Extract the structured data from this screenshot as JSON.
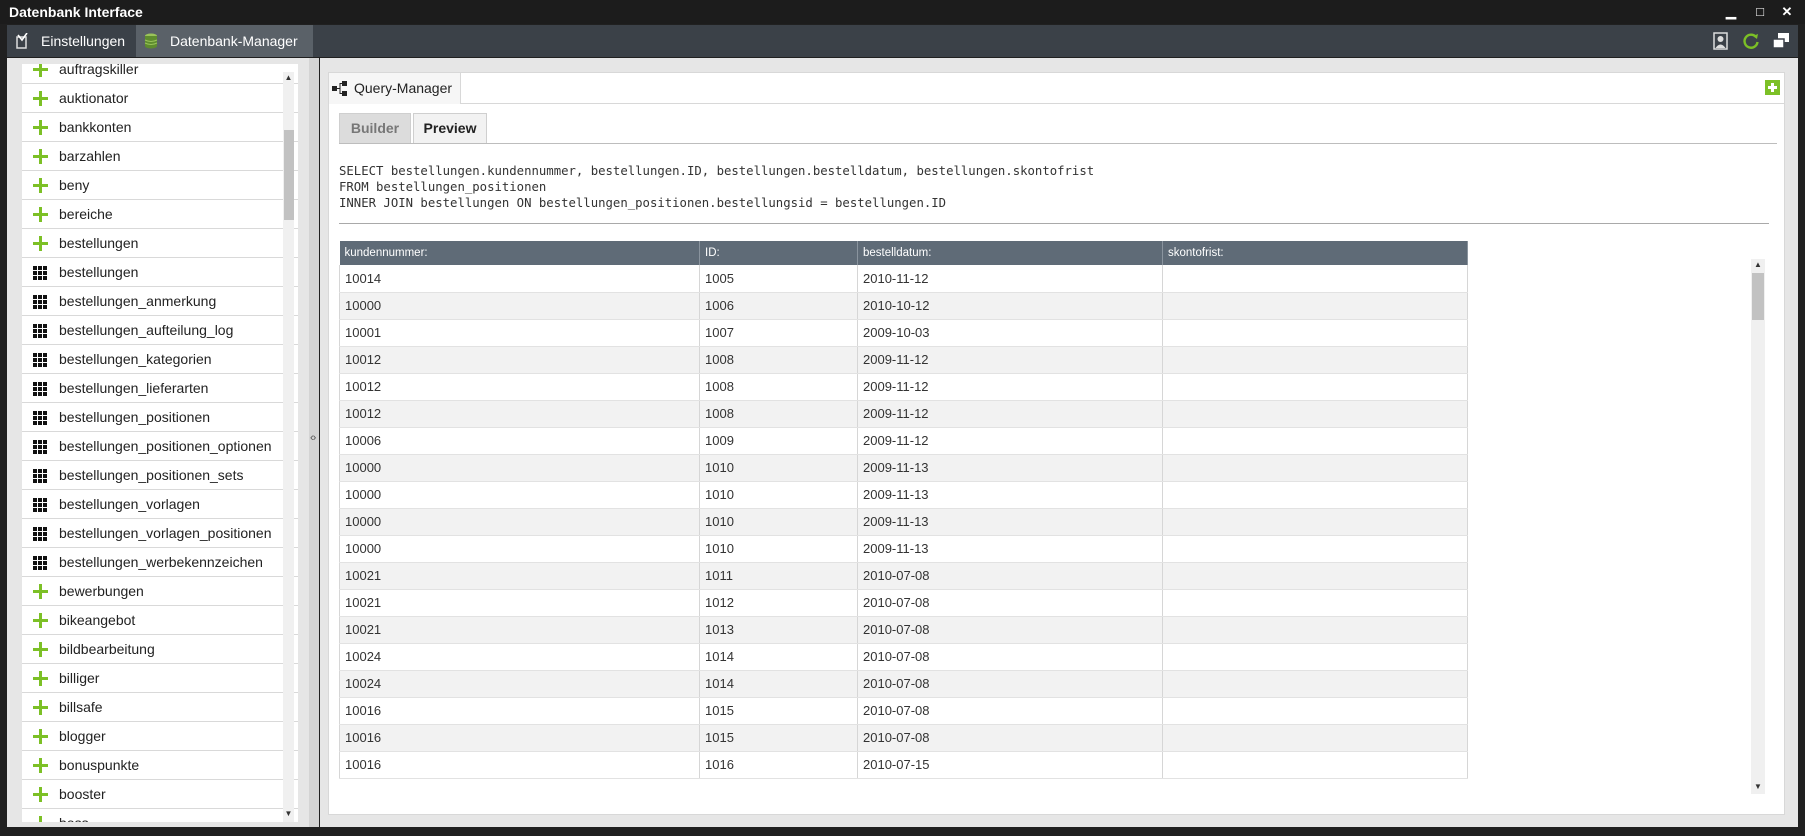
{
  "window": {
    "title": "Datenbank Interface",
    "minimize": "▁",
    "maximize": "□",
    "close": "✕"
  },
  "menubar": {
    "tabs": [
      {
        "label": "Einstellungen",
        "icon": "checklist-icon"
      },
      {
        "label": "Datenbank-Manager",
        "icon": "database-icon",
        "active": true
      }
    ],
    "right_icons": [
      "user-icon",
      "refresh-icon",
      "window-switch-icon"
    ]
  },
  "sidebar": {
    "items": [
      {
        "label": "auftragskiller",
        "icon": "plus"
      },
      {
        "label": "auktionator",
        "icon": "plus"
      },
      {
        "label": "bankkonten",
        "icon": "plus"
      },
      {
        "label": "barzahlen",
        "icon": "plus"
      },
      {
        "label": "beny",
        "icon": "plus"
      },
      {
        "label": "bereiche",
        "icon": "plus"
      },
      {
        "label": "bestellungen",
        "icon": "plus"
      },
      {
        "label": "bestellungen",
        "icon": "table"
      },
      {
        "label": "bestellungen_anmerkung",
        "icon": "table"
      },
      {
        "label": "bestellungen_aufteilung_log",
        "icon": "table"
      },
      {
        "label": "bestellungen_kategorien",
        "icon": "table"
      },
      {
        "label": "bestellungen_lieferarten",
        "icon": "table"
      },
      {
        "label": "bestellungen_positionen",
        "icon": "table"
      },
      {
        "label": "bestellungen_positionen_optionen",
        "icon": "table"
      },
      {
        "label": "bestellungen_positionen_sets",
        "icon": "table"
      },
      {
        "label": "bestellungen_vorlagen",
        "icon": "table"
      },
      {
        "label": "bestellungen_vorlagen_positionen",
        "icon": "table"
      },
      {
        "label": "bestellungen_werbekennzeichen",
        "icon": "table"
      },
      {
        "label": "bewerbungen",
        "icon": "plus"
      },
      {
        "label": "bikeangebot",
        "icon": "plus"
      },
      {
        "label": "bildbearbeitung",
        "icon": "plus"
      },
      {
        "label": "billiger",
        "icon": "plus"
      },
      {
        "label": "billsafe",
        "icon": "plus"
      },
      {
        "label": "blogger",
        "icon": "plus"
      },
      {
        "label": "bonuspunkte",
        "icon": "plus"
      },
      {
        "label": "booster",
        "icon": "plus"
      },
      {
        "label": "boss",
        "icon": "plus"
      }
    ],
    "splitter_glyph": "‹›"
  },
  "query_manager": {
    "title": "Query-Manager",
    "tabs": {
      "builder": "Builder",
      "preview": "Preview"
    },
    "sql": "SELECT bestellungen.kundennummer, bestellungen.ID, bestellungen.bestelldatum, bestellungen.skontofrist\nFROM bestellungen_positionen\nINNER JOIN bestellungen ON bestellungen_positionen.bestellungsid = bestellungen.ID",
    "columns": [
      "kundennummer:",
      "ID:",
      "bestelldatum:",
      "skontofrist:"
    ],
    "rows": [
      [
        "10014",
        "1005",
        "2010-11-12",
        ""
      ],
      [
        "10000",
        "1006",
        "2010-10-12",
        ""
      ],
      [
        "10001",
        "1007",
        "2009-10-03",
        ""
      ],
      [
        "10012",
        "1008",
        "2009-11-12",
        ""
      ],
      [
        "10012",
        "1008",
        "2009-11-12",
        ""
      ],
      [
        "10012",
        "1008",
        "2009-11-12",
        ""
      ],
      [
        "10006",
        "1009",
        "2009-11-12",
        ""
      ],
      [
        "10000",
        "1010",
        "2009-11-13",
        ""
      ],
      [
        "10000",
        "1010",
        "2009-11-13",
        ""
      ],
      [
        "10000",
        "1010",
        "2009-11-13",
        ""
      ],
      [
        "10000",
        "1010",
        "2009-11-13",
        ""
      ],
      [
        "10021",
        "1011",
        "2010-07-08",
        ""
      ],
      [
        "10021",
        "1012",
        "2010-07-08",
        ""
      ],
      [
        "10021",
        "1013",
        "2010-07-08",
        ""
      ],
      [
        "10024",
        "1014",
        "2010-07-08",
        ""
      ],
      [
        "10024",
        "1014",
        "2010-07-08",
        ""
      ],
      [
        "10016",
        "1015",
        "2010-07-08",
        ""
      ],
      [
        "10016",
        "1015",
        "2010-07-08",
        ""
      ],
      [
        "10016",
        "1016",
        "2010-07-15",
        ""
      ]
    ]
  },
  "colors": {
    "accent_green": "#7cc026",
    "header_gray": "#5f6b77",
    "menubar": "#3b4148"
  }
}
